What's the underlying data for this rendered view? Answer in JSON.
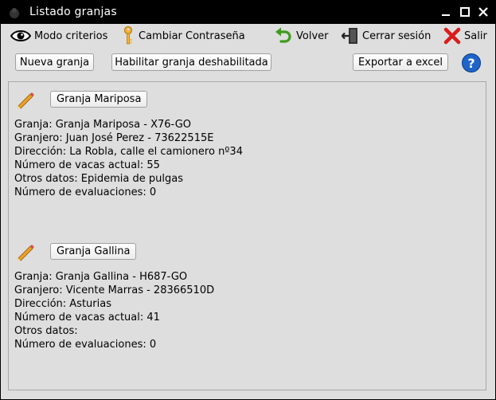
{
  "window": {
    "title": "Listado granjas"
  },
  "toolbar": {
    "criteria": "Modo criterios",
    "password": "Cambiar Contraseña",
    "back": "Volver",
    "logout": "Cerrar sesión",
    "exit": "Salir"
  },
  "actions": {
    "new_farm": "Nueva granja",
    "enable_farm": "Habilitar granja deshabilitada",
    "export": "Exportar a excel",
    "help": "?"
  },
  "farms": [
    {
      "button": "Granja Mariposa",
      "granja": "Granja: Granja Mariposa - X76-GO",
      "granjero": "Granjero: Juan José Perez - 73622515E",
      "direccion": "Dirección: La Robla, calle el camionero nº34",
      "vacas": "Número de vacas actual: 55",
      "otros": "Otros datos: Epidemia de pulgas",
      "evaluaciones": "Número de evaluaciones: 0"
    },
    {
      "button": "Granja Gallina",
      "granja": "Granja: Granja Gallina - H687-GO",
      "granjero": "Granjero: Vicente Marras - 28366510D",
      "direccion": "Dirección: Asturias",
      "vacas": "Número de vacas actual: 41",
      "otros": "Otros datos:",
      "evaluaciones": "Número de evaluaciones: 0"
    }
  ]
}
